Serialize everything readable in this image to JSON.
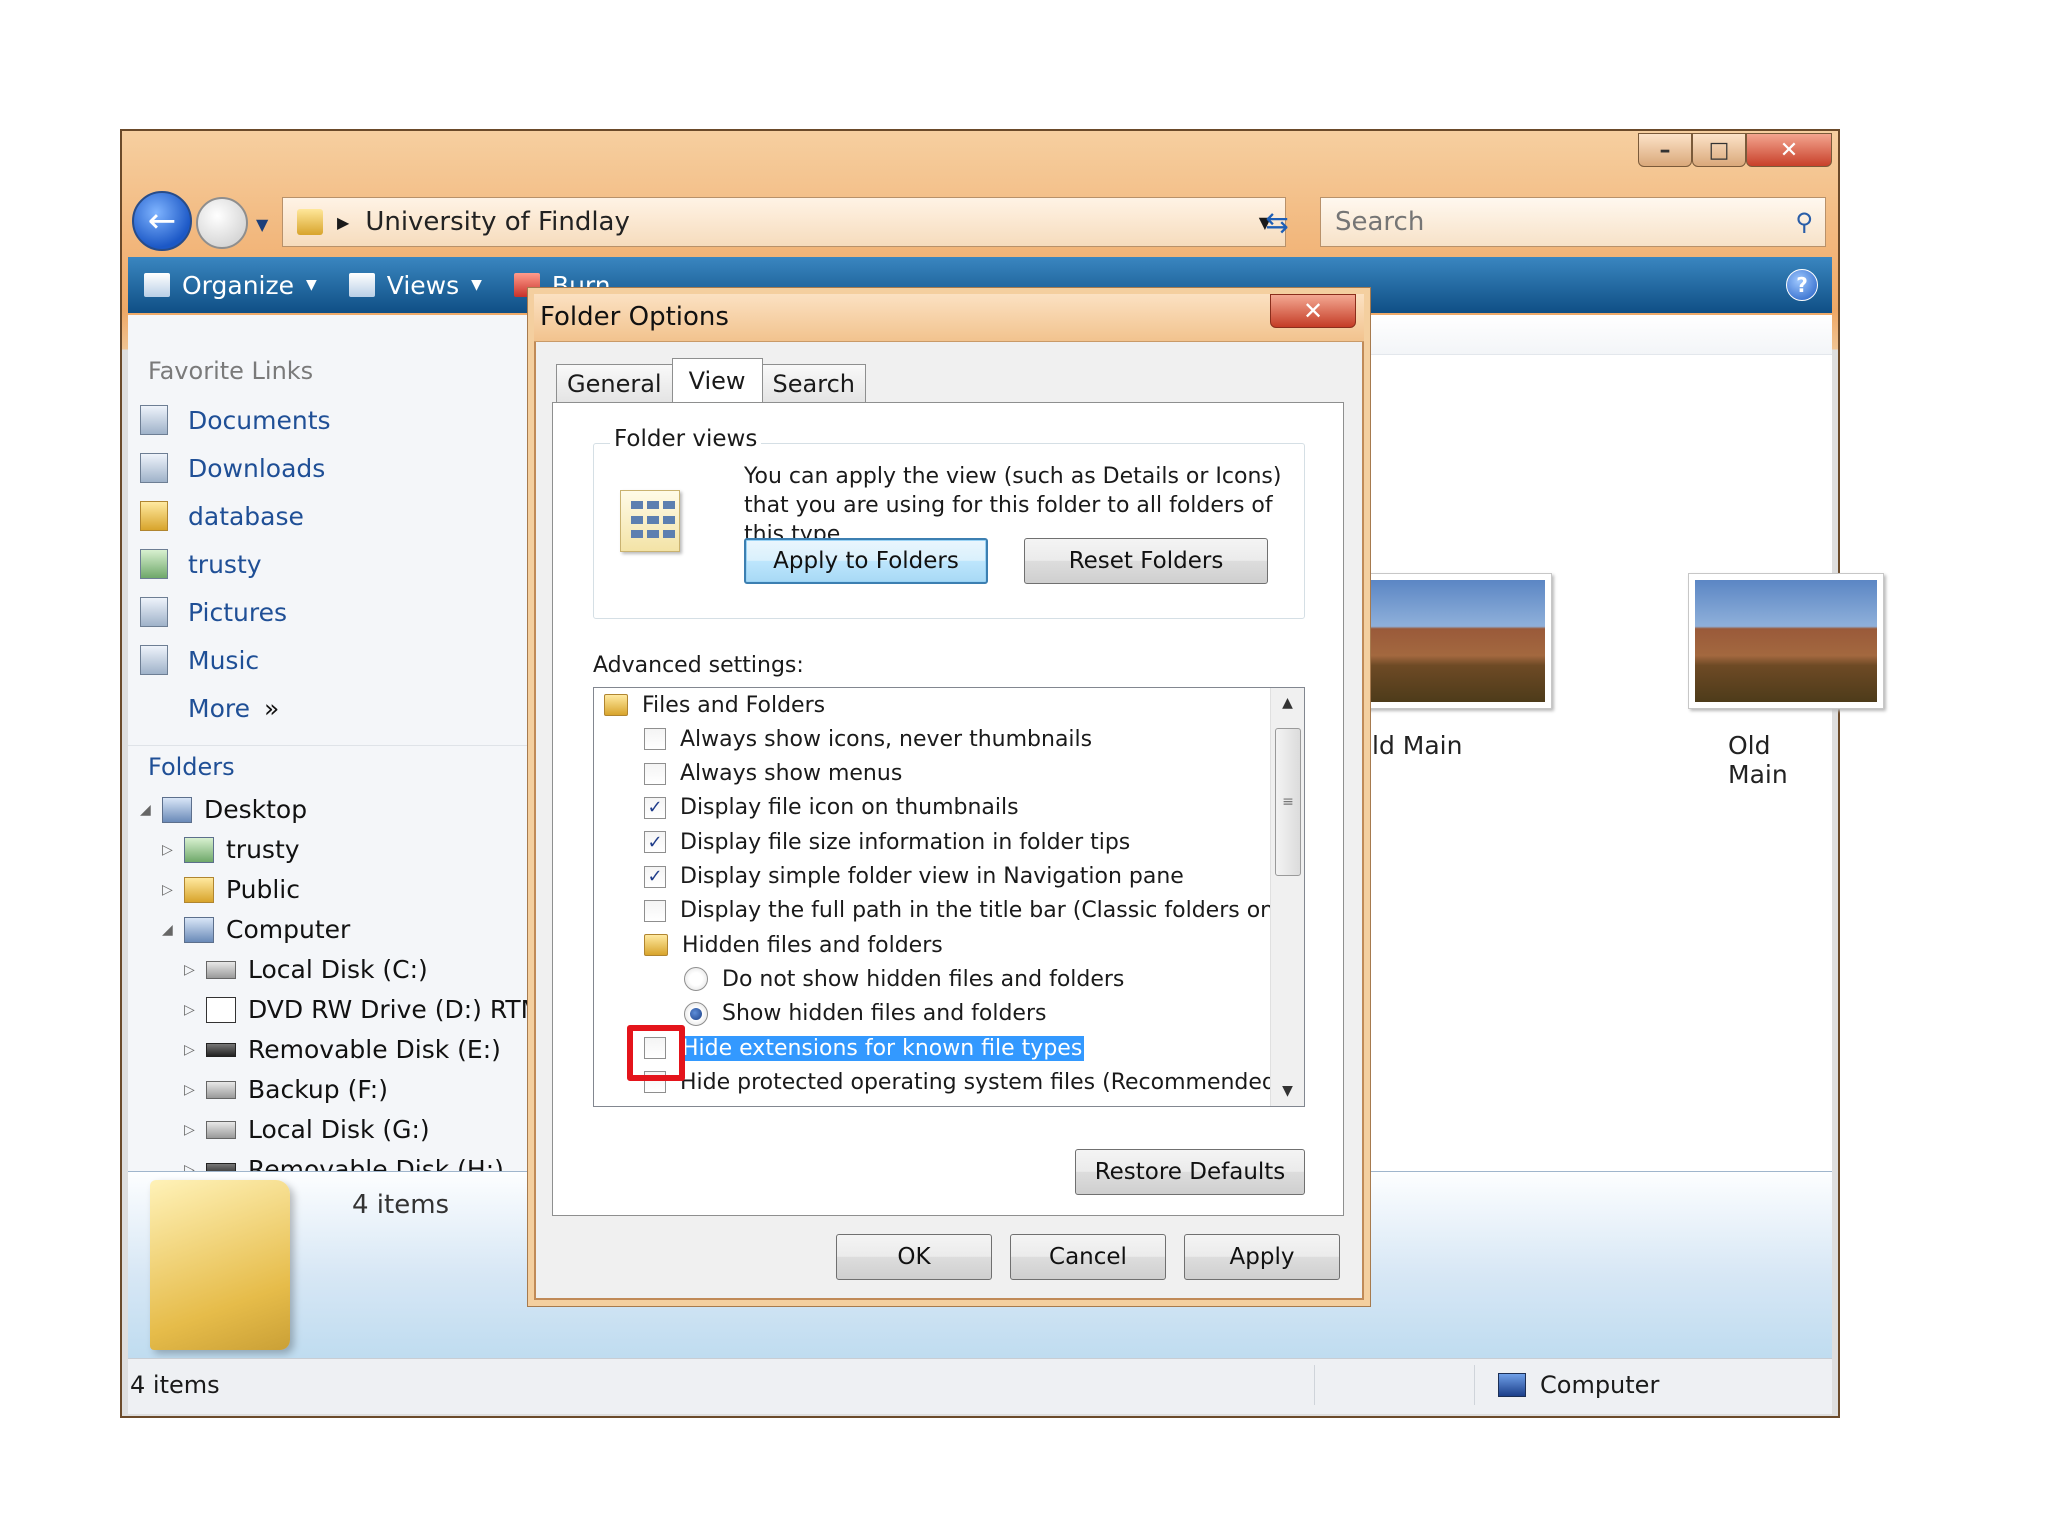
{
  "explorer": {
    "path": "University of Findlay",
    "search_placeholder": "Search",
    "toolbar": {
      "organize": "Organize",
      "views": "Views",
      "burn": "Burn"
    },
    "favorite_links_heading": "Favorite Links",
    "favorites": [
      "Documents",
      "Downloads",
      "database",
      "trusty",
      "Pictures",
      "Music"
    ],
    "more_label": "More",
    "folders_heading": "Folders",
    "tree": [
      "Desktop",
      "trusty",
      "Public",
      "Computer",
      "Local Disk (C:)",
      "DVD RW Drive (D:) RTMS",
      "Removable Disk (E:)",
      "Backup (F:)",
      "Local Disk (G:)",
      "Removable Disk (H:)"
    ],
    "thumbnails": [
      "ld Main",
      "Old Main"
    ],
    "details_count": "4 items",
    "status_left": "4 items",
    "status_right": "Computer"
  },
  "dialog": {
    "title": "Folder Options",
    "tabs": [
      "General",
      "View",
      "Search"
    ],
    "active_tab": "View",
    "folder_views_legend": "Folder views",
    "folder_views_text": "You can apply the view (such as Details or Icons) that you are using for this folder to all folders of this type.",
    "apply_to_folders": "Apply to Folders",
    "reset_folders": "Reset Folders",
    "advanced_label": "Advanced settings:",
    "settings": [
      {
        "label": "Files and Folders",
        "kind": "folder",
        "checked": false
      },
      {
        "label": "Always show icons, never thumbnails",
        "kind": "checkbox",
        "checked": false
      },
      {
        "label": "Always show menus",
        "kind": "checkbox",
        "checked": false
      },
      {
        "label": "Display file icon on thumbnails",
        "kind": "checkbox",
        "checked": true
      },
      {
        "label": "Display file size information in folder tips",
        "kind": "checkbox",
        "checked": true
      },
      {
        "label": "Display simple folder view in Navigation pane",
        "kind": "checkbox",
        "checked": true
      },
      {
        "label": "Display the full path in the title bar (Classic folders only)",
        "kind": "checkbox",
        "checked": false
      },
      {
        "label": "Hidden files and folders",
        "kind": "folder",
        "checked": false
      },
      {
        "label": "Do not show hidden files and folders",
        "kind": "radio",
        "checked": false
      },
      {
        "label": "Show hidden files and folders",
        "kind": "radio",
        "checked": true
      },
      {
        "label": "Hide extensions for known file types",
        "kind": "checkbox",
        "checked": false,
        "selected": true
      },
      {
        "label": "Hide protected operating system files (Recommended)",
        "kind": "checkbox",
        "checked": false
      }
    ],
    "restore_defaults": "Restore Defaults",
    "ok": "OK",
    "cancel": "Cancel",
    "apply": "Apply"
  },
  "colors": {
    "selection": "#3399ff",
    "highlight_box": "#e4141b",
    "toolbar": "#1a5c94"
  }
}
